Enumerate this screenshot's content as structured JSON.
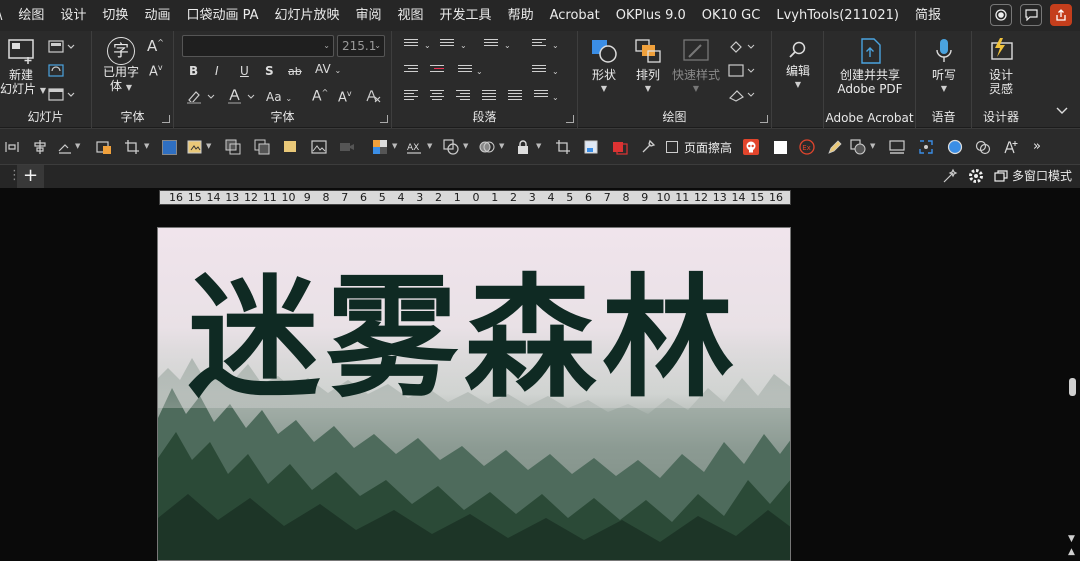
{
  "menu": {
    "items": [
      "\\",
      "绘图",
      "设计",
      "切换",
      "动画",
      "口袋动画 PA",
      "幻灯片放映",
      "审阅",
      "视图",
      "开发工具",
      "帮助",
      "Acrobat",
      "OKPlus 9.0",
      "OK10 GC",
      "LvyhTools(211021)",
      "简报"
    ]
  },
  "ribbon": {
    "slides_group": {
      "new_slide": "新建",
      "new_slide_2": "幻灯片",
      "label": "幻灯片"
    },
    "font_group1": {
      "used_fonts": "已用字",
      "used_fonts_2": "体",
      "label": "字体",
      "glyph": "字"
    },
    "font_group2": {
      "font_name": "",
      "font_size": "215.1",
      "label": "字体",
      "bold": "B",
      "italic": "I",
      "underline": "U",
      "shadow": "S",
      "strike": "ab",
      "spacing": "AV",
      "case": "Aa",
      "grow": "A",
      "shrink": "A"
    },
    "paragraph_group": {
      "label": "段落"
    },
    "drawing_group": {
      "shapes": "形状",
      "arrange": "排列",
      "quick_styles": "快速样式",
      "label": "绘图"
    },
    "editing_group": {
      "editing": "编辑"
    },
    "acrobat_group": {
      "create_share": "创建并共享",
      "adobe_pdf": "Adobe PDF",
      "label": "Adobe Acrobat"
    },
    "voice_group": {
      "dictate": "听写",
      "label": "语音"
    },
    "designer_group": {
      "design_ideas": "设计",
      "design_ideas_2": "灵感",
      "label": "设计器"
    }
  },
  "quickbar": {
    "page_erase": "页面擦高",
    "more": "»"
  },
  "tabbar": {
    "add": "+",
    "multi_window": "多窗口模式"
  },
  "ruler": {
    "ticks": [
      "16",
      "15",
      "14",
      "13",
      "12",
      "11",
      "10",
      "9",
      "8",
      "7",
      "6",
      "5",
      "4",
      "3",
      "2",
      "1",
      "0",
      "1",
      "2",
      "3",
      "4",
      "5",
      "6",
      "7",
      "8",
      "9",
      "10",
      "11",
      "12",
      "13",
      "14",
      "15",
      "16"
    ]
  },
  "slide": {
    "title": "迷雾森林"
  },
  "colors": {
    "menubar": "#262626",
    "ribbon": "#2b2b2b",
    "accent": "#c43e1c",
    "title": "#0f2a23"
  }
}
